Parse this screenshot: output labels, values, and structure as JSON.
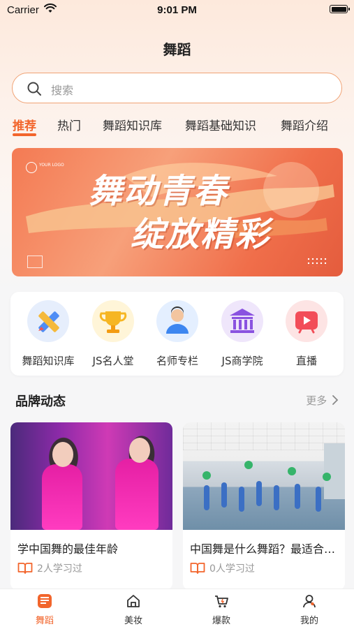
{
  "status_bar": {
    "carrier": "Carrier",
    "time": "9:01 PM"
  },
  "header": {
    "title": "舞蹈"
  },
  "search": {
    "placeholder": "搜索"
  },
  "tabs": [
    {
      "label": "推荐",
      "active": true
    },
    {
      "label": "热门"
    },
    {
      "label": "舞蹈知识库"
    },
    {
      "label": "舞蹈基础知识"
    },
    {
      "label": "舞蹈介绍"
    }
  ],
  "banner": {
    "line1": "舞动青春",
    "line2": "绽放精彩",
    "logo_text": "YOUR LOGO"
  },
  "quick_links": [
    {
      "label": "舞蹈知识库",
      "icon": "pencil-ruler-icon"
    },
    {
      "label": "JS名人堂",
      "icon": "trophy-icon"
    },
    {
      "label": "名师专栏",
      "icon": "teacher-icon"
    },
    {
      "label": "JS商学院",
      "icon": "institution-icon"
    },
    {
      "label": "直播",
      "icon": "live-play-icon"
    }
  ],
  "brand_news": {
    "title": "品牌动态",
    "more_label": "更多",
    "cards": [
      {
        "title": "学中国舞的最佳年龄",
        "learners": "2人学习过"
      },
      {
        "title": "中国舞是什么舞蹈？最适合几岁学",
        "learners": "0人学习过"
      }
    ]
  },
  "tab_bar": [
    {
      "label": "舞蹈",
      "icon": "dance-icon",
      "active": true
    },
    {
      "label": "美妆",
      "icon": "home-icon"
    },
    {
      "label": "爆款",
      "icon": "cart-icon"
    },
    {
      "label": "我的",
      "icon": "profile-icon"
    }
  ],
  "colors": {
    "accent": "#f2652c",
    "search_border": "#f0a274"
  }
}
